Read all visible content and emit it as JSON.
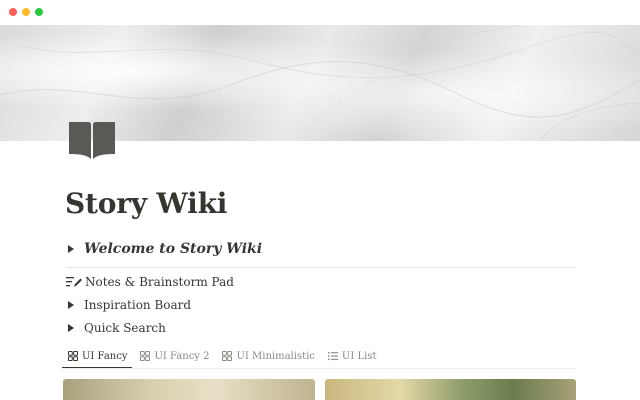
{
  "page": {
    "title": "Story Wiki",
    "icon": "book-icon"
  },
  "toggles": {
    "welcome": "Welcome to Story Wiki",
    "notes": "Notes & Brainstorm Pad",
    "inspiration": "Inspiration Board",
    "quick_search": "Quick Search"
  },
  "views": [
    {
      "label": "UI Fancy",
      "icon": "gallery-icon",
      "active": true
    },
    {
      "label": "UI Fancy 2",
      "icon": "gallery-icon",
      "active": false
    },
    {
      "label": "UI Minimalistic",
      "icon": "gallery-icon",
      "active": false
    },
    {
      "label": "UI List",
      "icon": "list-icon",
      "active": false
    }
  ],
  "colors": {
    "text": "#37352f",
    "muted": "#8a8984",
    "close": "#fe5f57",
    "minimize": "#febc2e",
    "maximize": "#28c840",
    "icon": "#5a5955"
  }
}
